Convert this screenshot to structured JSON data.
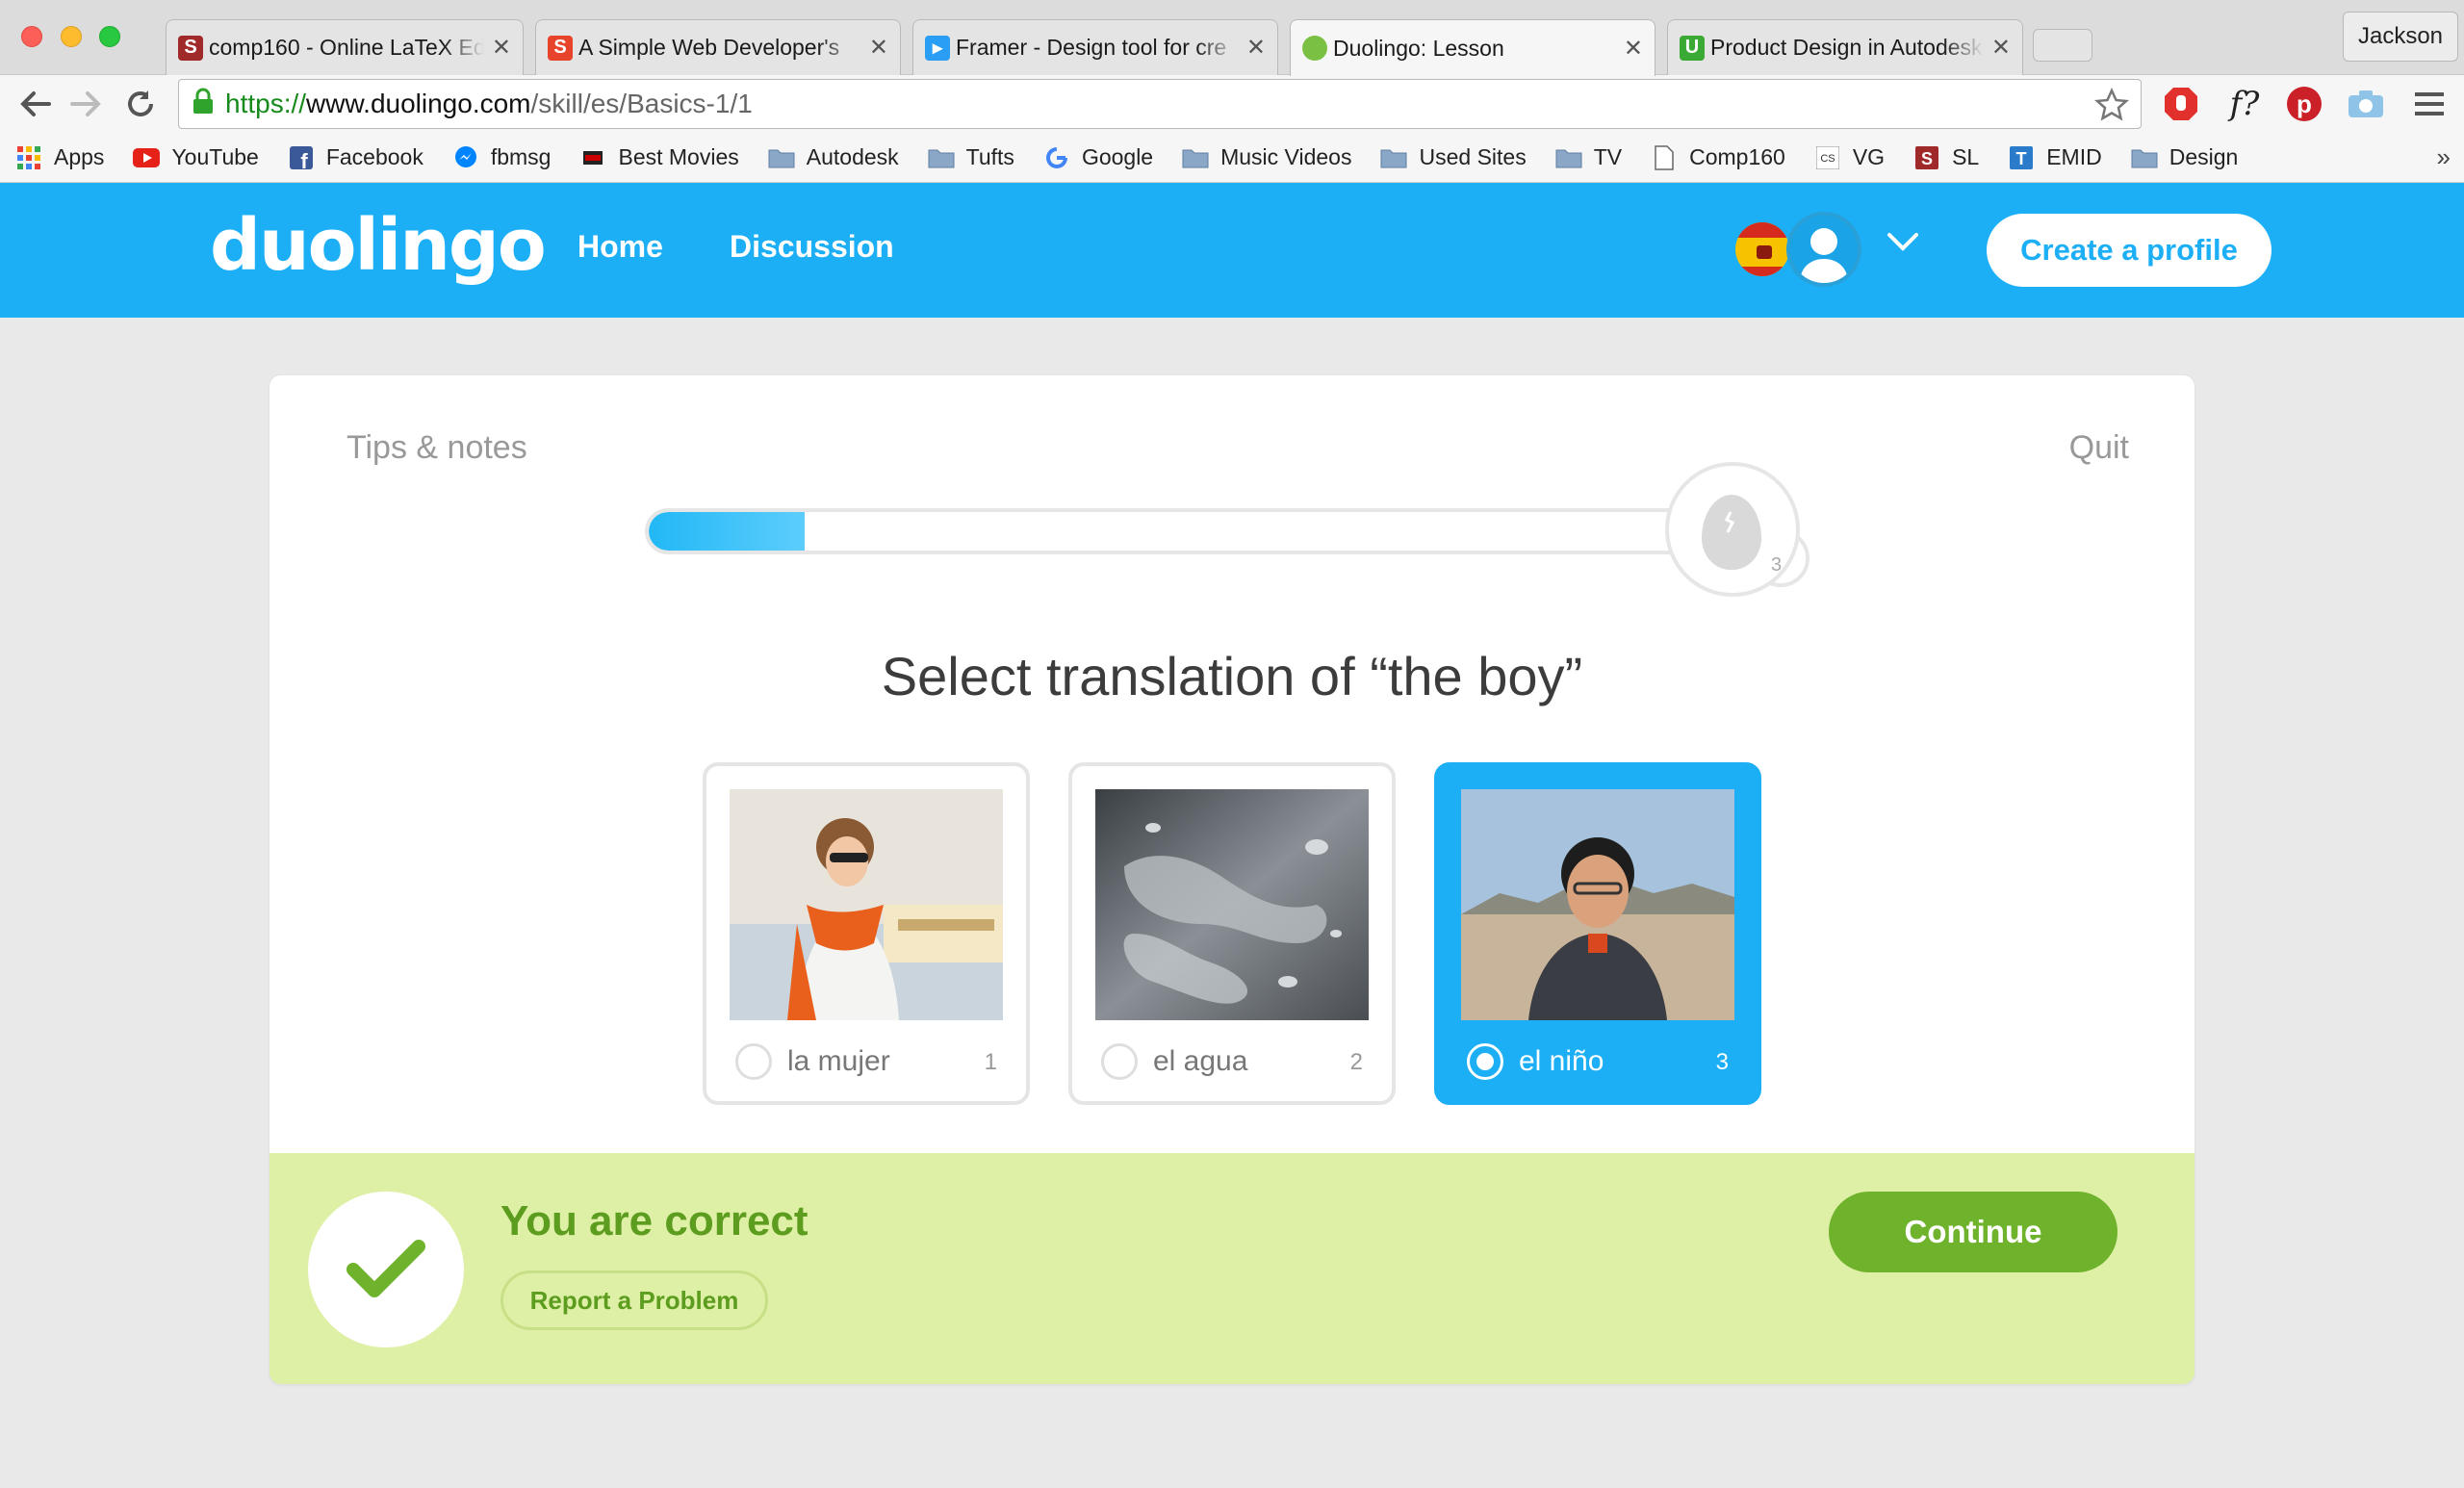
{
  "browser": {
    "profile_name": "Jackson",
    "tabs": [
      {
        "title": "comp160 - Online LaTeX Ed",
        "active": false
      },
      {
        "title": "A Simple Web Developer's",
        "active": false
      },
      {
        "title": "Framer - Design tool for cre",
        "active": false
      },
      {
        "title": "Duolingo: Lesson",
        "active": true
      },
      {
        "title": "Product Design in Autodesk",
        "active": false
      }
    ],
    "url": {
      "scheme": "https://",
      "host": "www.duolingo.com",
      "path": "/skill/es/Basics-1/1"
    },
    "bookmarks": [
      {
        "label": "Apps",
        "icon": "apps-grid-icon"
      },
      {
        "label": "YouTube",
        "icon": "youtube-icon"
      },
      {
        "label": "Facebook",
        "icon": "facebook-icon"
      },
      {
        "label": "fbmsg",
        "icon": "messenger-icon"
      },
      {
        "label": "Best Movies",
        "icon": "movies-icon"
      },
      {
        "label": "Autodesk",
        "icon": "folder-icon"
      },
      {
        "label": "Tufts",
        "icon": "folder-icon"
      },
      {
        "label": "Google",
        "icon": "google-icon"
      },
      {
        "label": "Music Videos",
        "icon": "folder-icon"
      },
      {
        "label": "Used Sites",
        "icon": "folder-icon"
      },
      {
        "label": "TV",
        "icon": "folder-icon"
      },
      {
        "label": "Comp160",
        "icon": "page-icon"
      },
      {
        "label": "VG",
        "icon": "cs-icon"
      },
      {
        "label": "SL",
        "icon": "s-icon"
      },
      {
        "label": "EMID",
        "icon": "t-icon"
      },
      {
        "label": "Design",
        "icon": "folder-icon"
      }
    ],
    "bookmarks_more": "»"
  },
  "header": {
    "logo": "duolingo",
    "nav": {
      "home": "Home",
      "discussion": "Discussion"
    },
    "create_profile": "Create a profile"
  },
  "lesson": {
    "tips": "Tips & notes",
    "quit": "Quit",
    "progress_fraction": 0.15,
    "egg_count": "3",
    "prompt": "Select translation of “the boy”",
    "choices": [
      {
        "label": "la mujer",
        "number": "1",
        "selected": false
      },
      {
        "label": "el agua",
        "number": "2",
        "selected": false
      },
      {
        "label": "el niño",
        "number": "3",
        "selected": true
      }
    ]
  },
  "feedback": {
    "message": "You are correct",
    "report": "Report a Problem",
    "continue": "Continue"
  },
  "colors": {
    "duo_blue": "#1caff6",
    "correct_green": "#5c9c1e",
    "feedback_bg": "#def0a5",
    "continue_bg": "#6fb22c"
  }
}
